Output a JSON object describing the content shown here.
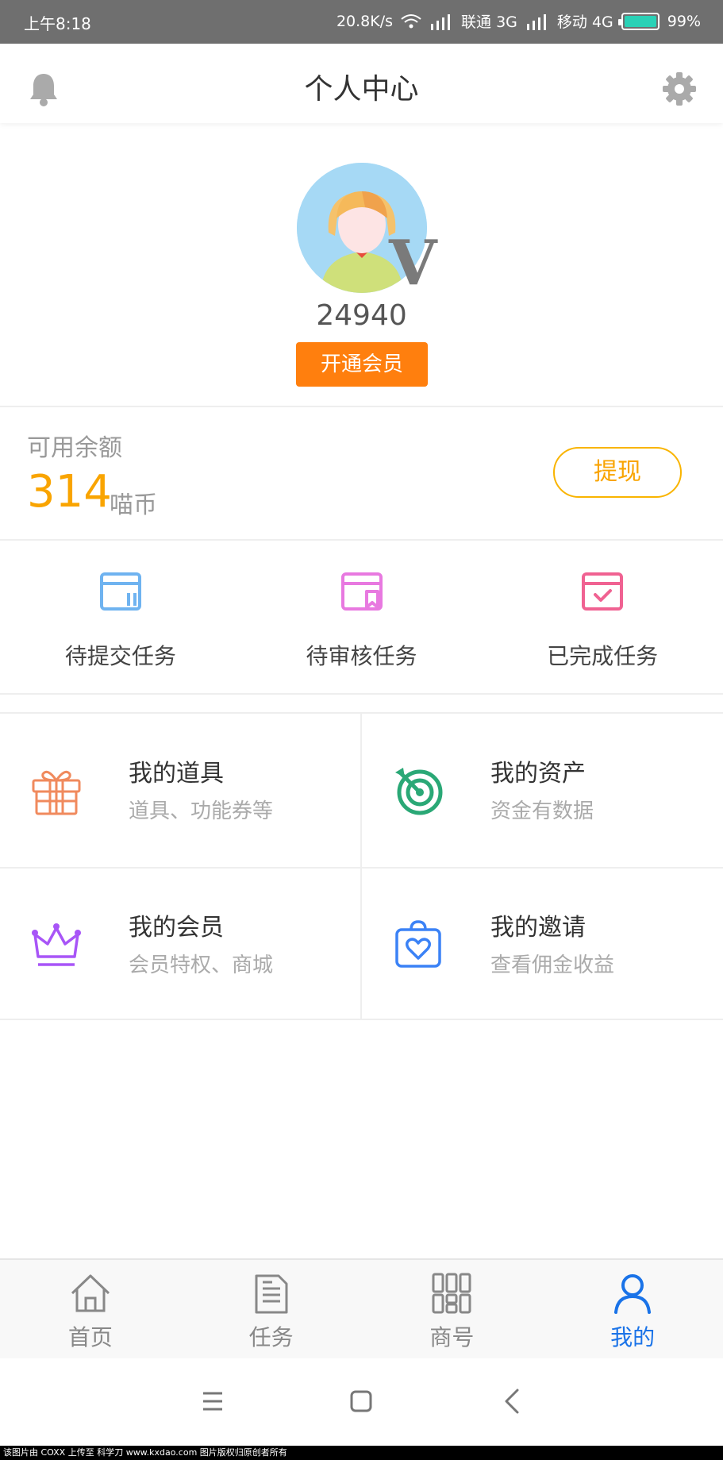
{
  "status_bar": {
    "time": "上午8:18",
    "speed": "20.8K/s",
    "carrier1": "联通 3G",
    "carrier2": "移动 4G",
    "battery": "99%"
  },
  "header": {
    "title": "个人中心",
    "left_icon": "bell-icon",
    "right_icon": "gear-icon"
  },
  "profile": {
    "user_id": "24940",
    "vip_mark": "V",
    "vip_button": "开通会员"
  },
  "balance": {
    "label": "可用余额",
    "amount": "314",
    "unit": "喵币",
    "withdraw_button": "提现"
  },
  "tasks": [
    {
      "label": "待提交任务",
      "icon": "pending-submit-icon",
      "color": "#6fb3f0"
    },
    {
      "label": "待审核任务",
      "icon": "pending-review-icon",
      "color": "#e879e0"
    },
    {
      "label": "已完成任务",
      "icon": "completed-task-icon",
      "color": "#f06292"
    }
  ],
  "grid": [
    {
      "title": "我的道具",
      "subtitle": "道具、功能券等",
      "icon": "gift-icon",
      "color": "#f08a5d"
    },
    {
      "title": "我的资产",
      "subtitle": "资金有数据",
      "icon": "target-icon",
      "color": "#2aa876"
    },
    {
      "title": "我的会员",
      "subtitle": "会员特权、商城",
      "icon": "crown-icon",
      "color": "#a855f7"
    },
    {
      "title": "我的邀请",
      "subtitle": "查看佣金收益",
      "icon": "invite-heart-icon",
      "color": "#3b82f6"
    }
  ],
  "tabbar": [
    {
      "label": "首页",
      "icon": "home-icon",
      "active": false
    },
    {
      "label": "任务",
      "icon": "document-icon",
      "active": false
    },
    {
      "label": "商号",
      "icon": "grid-icon",
      "active": false
    },
    {
      "label": "我的",
      "icon": "user-icon",
      "active": true
    }
  ],
  "colors": {
    "accent": "#ff7f0e",
    "balance": "#f9a400",
    "active_tab": "#1a73e8"
  },
  "footer": "该图片由 COXX 上传至 科学刀 www.kxdao.com 图片版权归原创者所有"
}
